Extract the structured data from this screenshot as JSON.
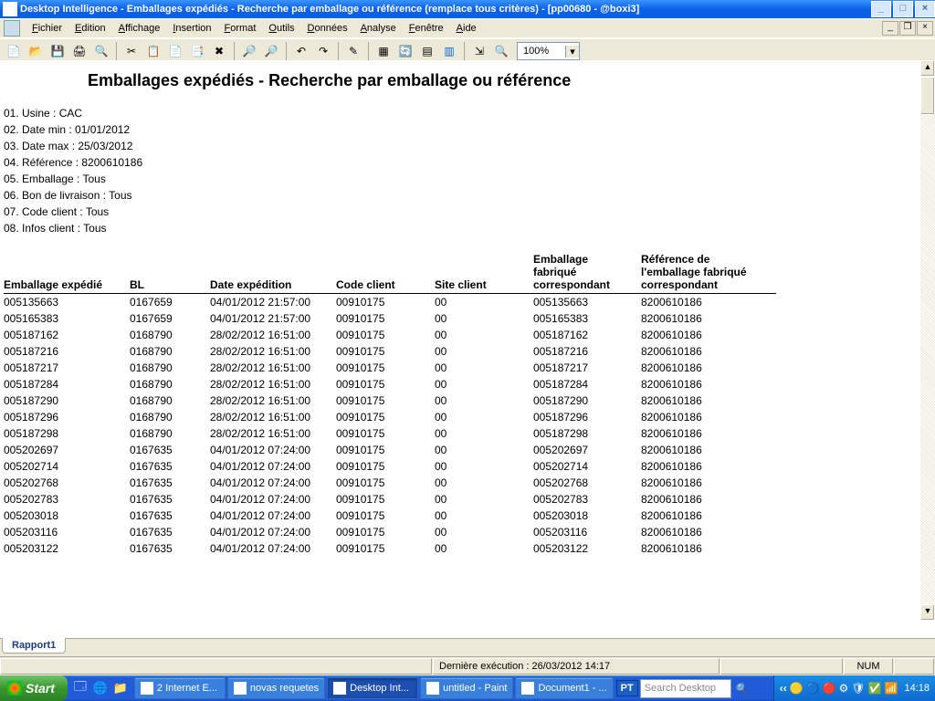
{
  "window": {
    "title": "Desktop Intelligence - Emballages expédiés - Recherche par emballage ou référence (remplace tous critères) - [pp00680 - @boxi3]"
  },
  "menu": {
    "items": [
      "Fichier",
      "Edition",
      "Affichage",
      "Insertion",
      "Format",
      "Outils",
      "Données",
      "Analyse",
      "Fenêtre",
      "Aide"
    ]
  },
  "zoom": {
    "value": "100%"
  },
  "report": {
    "title": "Emballages expédiés - Recherche par emballage ou référence",
    "params": [
      "01. Usine : CAC",
      "02. Date min : 01/01/2012",
      "03. Date max : 25/03/2012",
      "04. Référence : 8200610186",
      "05. Emballage : Tous",
      "06. Bon de livraison : Tous",
      "07. Code client : Tous",
      "08. Infos client : Tous"
    ],
    "columns": [
      "Emballage expédié",
      "BL",
      "Date expédition",
      "Code client",
      "Site client",
      "Emballage fabriqué correspondant",
      "Référence de l'emballage fabriqué correspondant"
    ],
    "rows": [
      [
        "005135663",
        "0167659",
        "04/01/2012 21:57:00",
        "00910175",
        "00",
        "005135663",
        "8200610186"
      ],
      [
        "005165383",
        "0167659",
        "04/01/2012 21:57:00",
        "00910175",
        "00",
        "005165383",
        "8200610186"
      ],
      [
        "005187162",
        "0168790",
        "28/02/2012 16:51:00",
        "00910175",
        "00",
        "005187162",
        "8200610186"
      ],
      [
        "005187216",
        "0168790",
        "28/02/2012 16:51:00",
        "00910175",
        "00",
        "005187216",
        "8200610186"
      ],
      [
        "005187217",
        "0168790",
        "28/02/2012 16:51:00",
        "00910175",
        "00",
        "005187217",
        "8200610186"
      ],
      [
        "005187284",
        "0168790",
        "28/02/2012 16:51:00",
        "00910175",
        "00",
        "005187284",
        "8200610186"
      ],
      [
        "005187290",
        "0168790",
        "28/02/2012 16:51:00",
        "00910175",
        "00",
        "005187290",
        "8200610186"
      ],
      [
        "005187296",
        "0168790",
        "28/02/2012 16:51:00",
        "00910175",
        "00",
        "005187296",
        "8200610186"
      ],
      [
        "005187298",
        "0168790",
        "28/02/2012 16:51:00",
        "00910175",
        "00",
        "005187298",
        "8200610186"
      ],
      [
        "005202697",
        "0167635",
        "04/01/2012 07:24:00",
        "00910175",
        "00",
        "005202697",
        "8200610186"
      ],
      [
        "005202714",
        "0167635",
        "04/01/2012 07:24:00",
        "00910175",
        "00",
        "005202714",
        "8200610186"
      ],
      [
        "005202768",
        "0167635",
        "04/01/2012 07:24:00",
        "00910175",
        "00",
        "005202768",
        "8200610186"
      ],
      [
        "005202783",
        "0167635",
        "04/01/2012 07:24:00",
        "00910175",
        "00",
        "005202783",
        "8200610186"
      ],
      [
        "005203018",
        "0167635",
        "04/01/2012 07:24:00",
        "00910175",
        "00",
        "005203018",
        "8200610186"
      ],
      [
        "005203116",
        "0167635",
        "04/01/2012 07:24:00",
        "00910175",
        "00",
        "005203116",
        "8200610186"
      ],
      [
        "005203122",
        "0167635",
        "04/01/2012 07:24:00",
        "00910175",
        "00",
        "005203122",
        "8200610186"
      ]
    ]
  },
  "tab": {
    "label": "Rapport1"
  },
  "status": {
    "last_exec": "Dernière exécution : 26/03/2012 14:17",
    "num": "NUM"
  },
  "taskbar": {
    "start": "Start",
    "tasks": [
      {
        "label": "2 Internet E..."
      },
      {
        "label": "novas requetes"
      },
      {
        "label": "Desktop Int...",
        "active": true
      },
      {
        "label": "untitled - Paint"
      },
      {
        "label": "Document1 - ..."
      }
    ],
    "pt": "PT",
    "search": "Search Desktop",
    "clock": "14:18"
  }
}
